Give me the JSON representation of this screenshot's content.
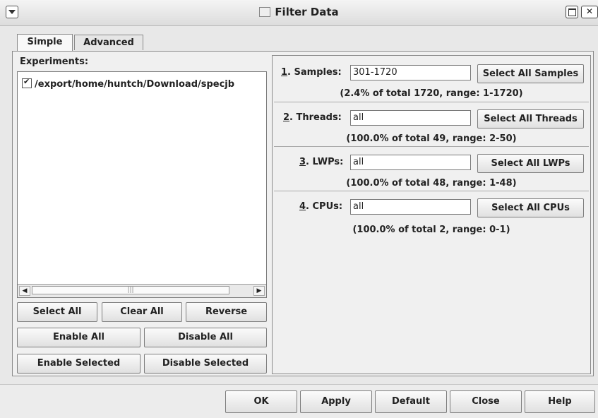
{
  "window": {
    "title": "Filter Data"
  },
  "tabs": [
    {
      "label": "Simple"
    },
    {
      "label": "Advanced"
    }
  ],
  "experiments": {
    "label": "Experiments:",
    "items": [
      {
        "label": "/export/home/huntch/Download/specjb",
        "checked": true
      }
    ]
  },
  "experiment_buttons": {
    "select_all": "Select All",
    "clear_all": "Clear All",
    "reverse": "Reverse",
    "enable_all": "Enable All",
    "disable_all": "Disable All",
    "enable_selected": "Enable Selected",
    "disable_selected": "Disable Selected"
  },
  "filters": [
    {
      "num": "1",
      "name": ". Samples:",
      "value": "301-1720",
      "button": "Select All Samples",
      "note": "(2.4% of total 1720, range: 1-1720)"
    },
    {
      "num": "2",
      "name": ". Threads:",
      "value": "all",
      "button": "Select All Threads",
      "note": "(100.0% of total 49, range: 2-50)"
    },
    {
      "num": "3",
      "name": ". LWPs:",
      "value": "all",
      "button": "Select All LWPs",
      "note": "(100.0% of total 48, range: 1-48)"
    },
    {
      "num": "4",
      "name": ". CPUs:",
      "value": "all",
      "button": "Select All CPUs",
      "note": "(100.0% of total 2, range: 0-1)"
    }
  ],
  "bottom_buttons": {
    "ok": "OK",
    "apply": "Apply",
    "default": "Default",
    "close": "Close",
    "help": "Help"
  }
}
